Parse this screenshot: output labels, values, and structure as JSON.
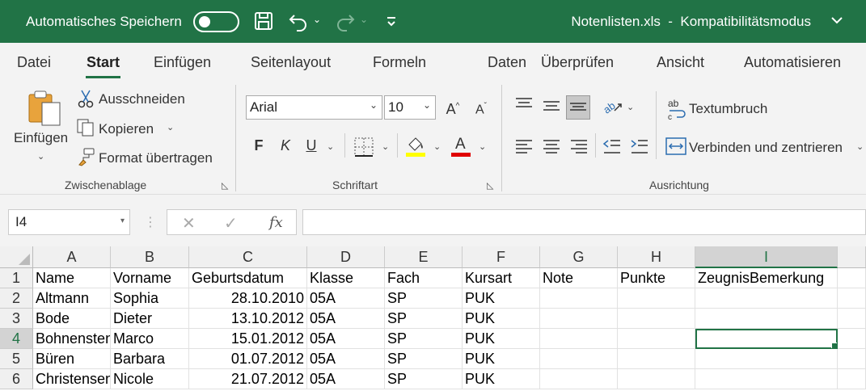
{
  "titlebar": {
    "autosave_label": "Automatisches Speichern",
    "document_title": "Notenlisten.xls  -  Kompatibilitätsmodus"
  },
  "menu": {
    "tabs": [
      {
        "label": "Datei"
      },
      {
        "label": "Start"
      },
      {
        "label": "Einfügen"
      },
      {
        "label": "Seitenlayout"
      },
      {
        "label": "Formeln"
      },
      {
        "label": "Daten"
      },
      {
        "label": "Überprüfen"
      },
      {
        "label": "Ansicht"
      },
      {
        "label": "Automatisieren"
      }
    ]
  },
  "ribbon": {
    "clipboard": {
      "paste_label": "Einfügen",
      "cut_label": "Ausschneiden",
      "copy_label": "Kopieren",
      "format_painter_label": "Format übertragen",
      "group_label": "Zwischenablage"
    },
    "font": {
      "font_name": "Arial",
      "font_size": "10",
      "bold_label": "F",
      "italic_label": "K",
      "underline_label": "U",
      "group_label": "Schriftart",
      "highlight_color": "#ffff00",
      "font_color": "#e00000"
    },
    "alignment": {
      "wrap_text_label": "Textumbruch",
      "merge_center_label": "Verbinden und zentrieren",
      "group_label": "Ausrichtung"
    }
  },
  "formula_bar": {
    "name_box": "I4",
    "formula": ""
  },
  "sheet": {
    "columns": [
      "A",
      "B",
      "C",
      "D",
      "E",
      "F",
      "G",
      "H",
      "I"
    ],
    "rows": [
      {
        "num": "1",
        "cells": [
          "Name",
          "Vorname",
          "Geburtsdatum",
          "Klasse",
          "Fach",
          "Kursart",
          "Note",
          "Punkte",
          "ZeugnisBemerkung"
        ]
      },
      {
        "num": "2",
        "cells": [
          "Altmann",
          "Sophia",
          "28.10.2010",
          "05A",
          "SP",
          "PUK",
          "",
          "",
          ""
        ]
      },
      {
        "num": "3",
        "cells": [
          "Bode",
          "Dieter",
          "13.10.2012",
          "05A",
          "SP",
          "PUK",
          "",
          "",
          ""
        ]
      },
      {
        "num": "4",
        "cells": [
          "Bohnenstengel",
          "Marco",
          "15.01.2012",
          "05A",
          "SP",
          "PUK",
          "",
          "",
          ""
        ]
      },
      {
        "num": "5",
        "cells": [
          "Büren",
          "Barbara",
          "01.07.2012",
          "05A",
          "SP",
          "PUK",
          "",
          "",
          ""
        ]
      },
      {
        "num": "6",
        "cells": [
          "Christensen",
          "Nicole",
          "21.07.2012",
          "05A",
          "SP",
          "PUK",
          "",
          "",
          ""
        ]
      }
    ],
    "selected_cell": "I4",
    "accent_color": "#217346"
  }
}
